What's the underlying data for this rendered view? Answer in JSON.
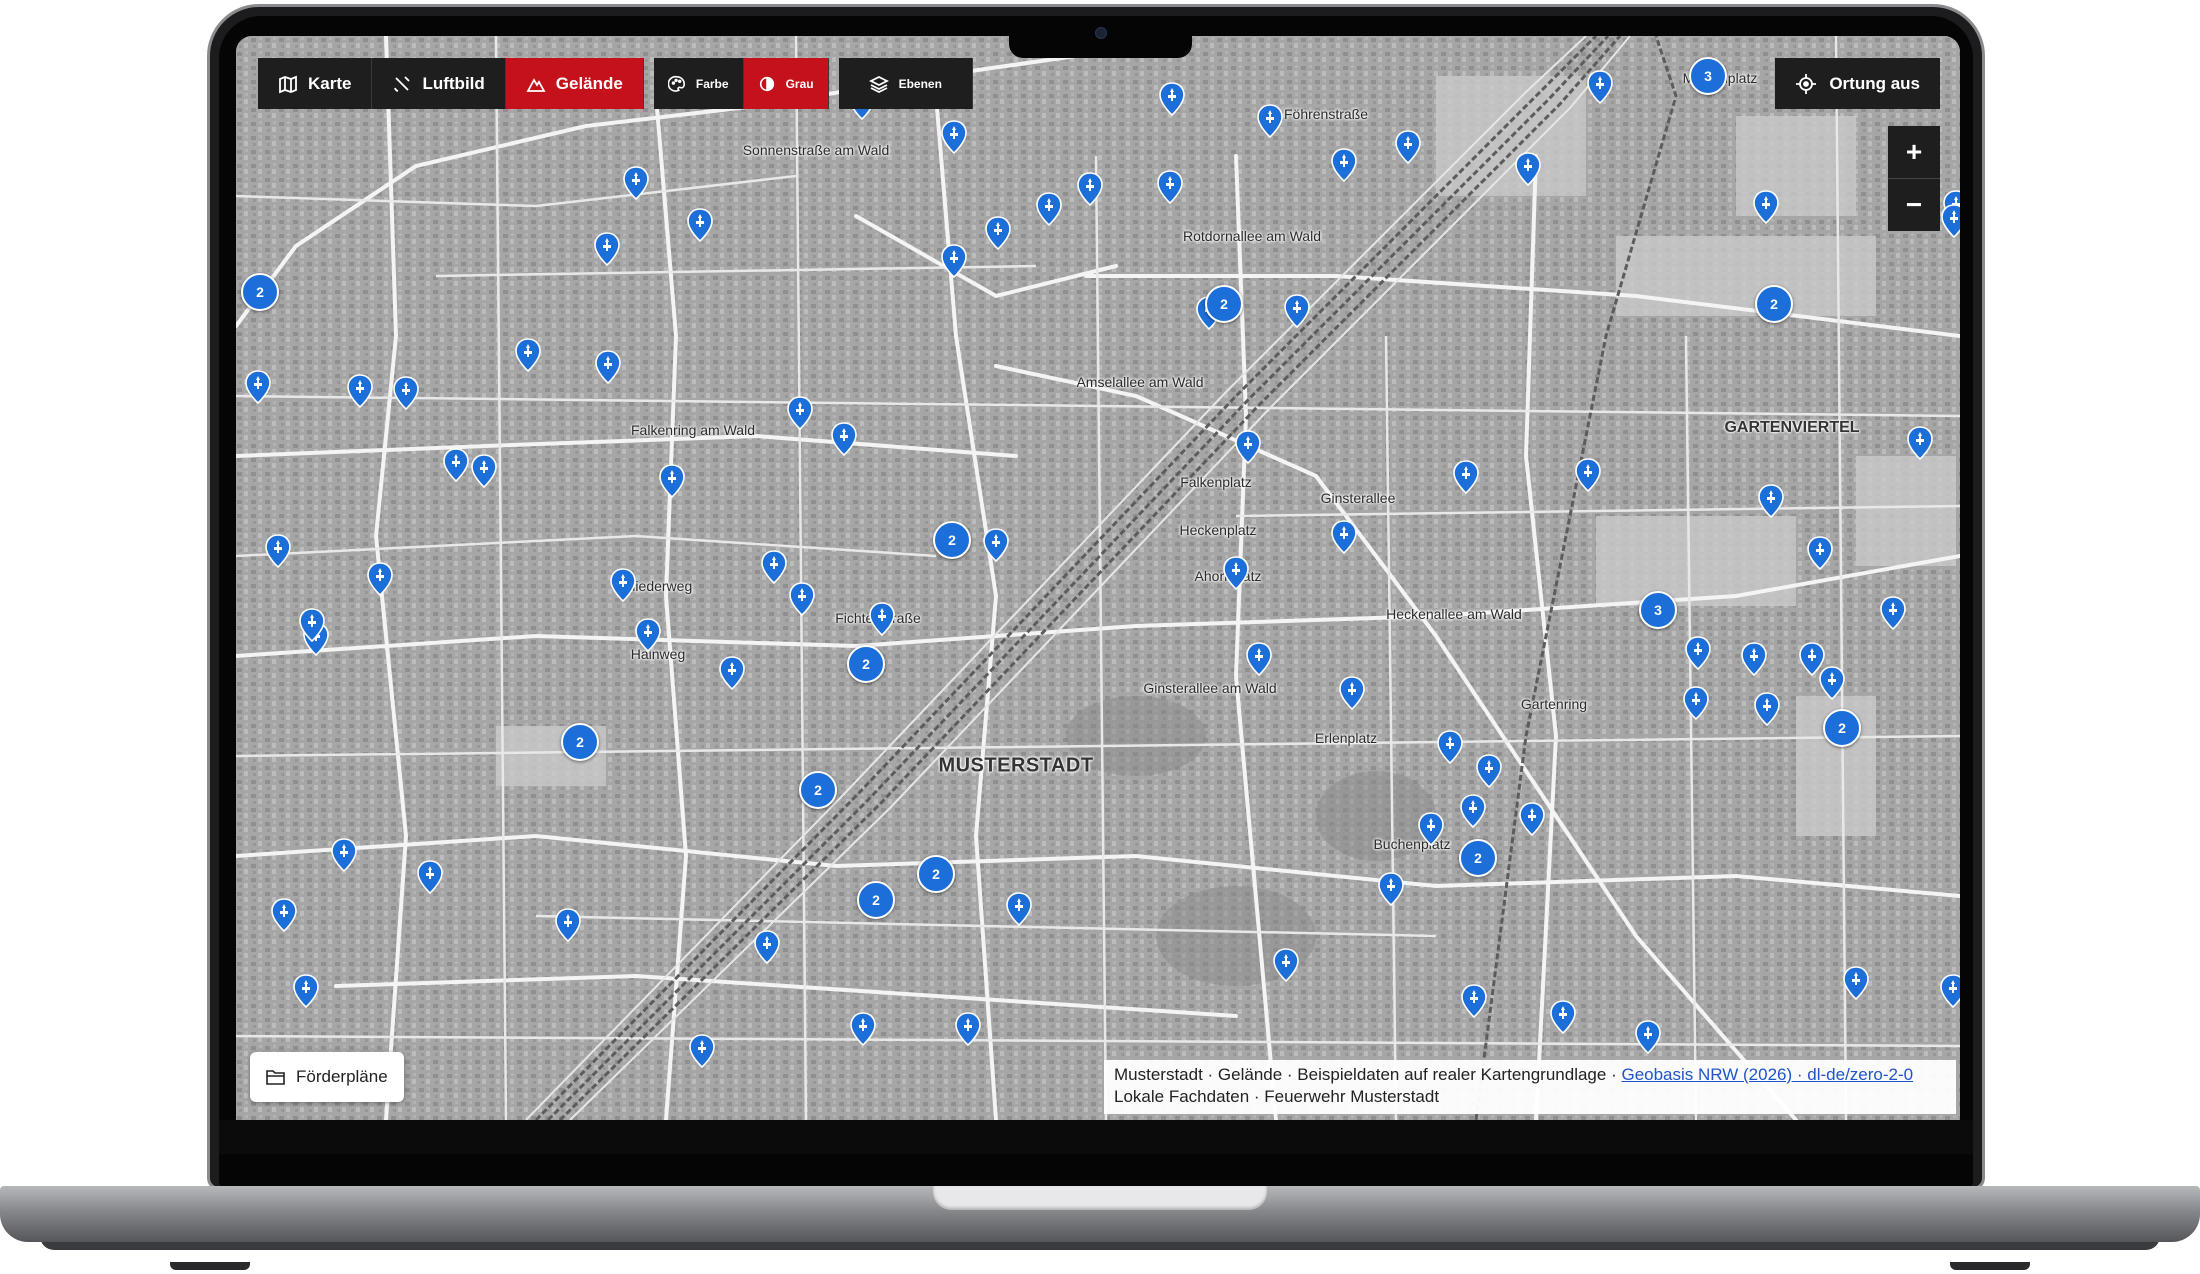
{
  "toolbar": {
    "map_modes": [
      {
        "label": "Karte",
        "icon": "map-icon",
        "active": false
      },
      {
        "label": "Luftbild",
        "icon": "satellite-icon",
        "active": false
      },
      {
        "label": "Gelände",
        "icon": "mountain-icon",
        "active": true
      }
    ],
    "color_modes": [
      {
        "label": "Farbe",
        "icon": "palette-icon",
        "active": false
      },
      {
        "label": "Grau",
        "icon": "contrast-icon",
        "active": true
      }
    ],
    "layers": {
      "label": "Ebenen",
      "icon": "layers-icon"
    }
  },
  "locate_button": {
    "label": "Ortung aus",
    "icon": "crosshair-icon"
  },
  "zoom": {
    "in": "+",
    "out": "−"
  },
  "plans_button": {
    "label": "Förderpläne",
    "icon": "folder-icon"
  },
  "attribution": {
    "line1": "Musterstadt · Gelände · Beispieldaten auf realer Kartengrundlage ·",
    "link": "Geobasis NRW (2026) · dl-de/zero-2-0",
    "line2": "Lokale Fachdaten · Feuerwehr Musterstadt"
  },
  "map": {
    "city_label": "MUSTERSTADT",
    "district_label": "GARTENVIERTEL",
    "street_labels": [
      "Föhrenstraße",
      "Sonnenstraße am Wald",
      "Rotdornallee am Wald",
      "Amselallee am Wald",
      "Falkenring am Wald",
      "Falkenplatz",
      "Ginsterallee",
      "Heckenplatz",
      "Ahornplatz",
      "Fliederweg",
      "Fichtenstraße",
      "Hainweg",
      "Heckenallee am Wald",
      "Ginsterallee am Wald",
      "Gartenring",
      "Erlenplatz",
      "Buchenplatz",
      "Meisenplatz"
    ],
    "clusters": [
      "3",
      "2",
      "2",
      "2",
      "2",
      "2",
      "3",
      "2",
      "2",
      "2",
      "2",
      "2",
      "2"
    ],
    "colors": {
      "marker": "#1c6fd8",
      "active": "#c4111b",
      "control": "#1e1e1e"
    }
  }
}
